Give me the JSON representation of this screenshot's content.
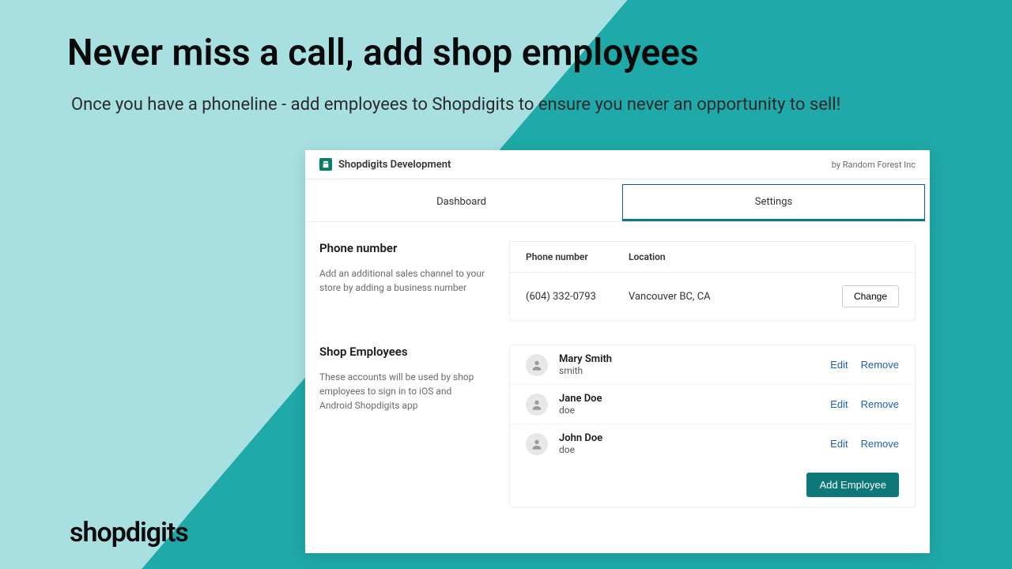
{
  "hero": {
    "title": "Never miss a call, add shop employees",
    "subtitle": "Once you have a phoneline - add employees to Shopdigits to ensure you never an opportunity to sell!"
  },
  "brand": "shopdigits",
  "app": {
    "title": "Shopdigits Development",
    "byline": "by Random Forest Inc"
  },
  "tabs": {
    "dashboard": "Dashboard",
    "settings": "Settings"
  },
  "phone": {
    "section_title": "Phone number",
    "section_desc": "Add an additional sales channel to your store by adding a business number",
    "col_number": "Phone number",
    "col_location": "Location",
    "number": "(604) 332-0793",
    "location": "Vancouver BC, CA",
    "change": "Change"
  },
  "employees": {
    "section_title": "Shop Employees",
    "section_desc": "These accounts will be used by shop employees to sign in to iOS and Android Shopdigits app",
    "edit": "Edit",
    "remove": "Remove",
    "add": "Add Employee",
    "list": [
      {
        "name": "Mary Smith",
        "user": "smith"
      },
      {
        "name": "Jane Doe",
        "user": "doe"
      },
      {
        "name": "John Doe",
        "user": "doe"
      }
    ]
  }
}
